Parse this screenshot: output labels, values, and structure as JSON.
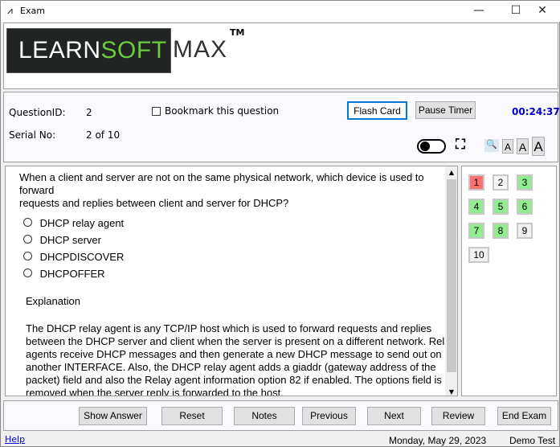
{
  "window": {
    "title": "Exam",
    "minimize": "—",
    "maximize": "☐",
    "close": "✕"
  },
  "logo": {
    "learn": "LEARN",
    "soft": "SOFT",
    "max": "MAX",
    "tm": "TM"
  },
  "info": {
    "question_id_label": "QuestionID:",
    "question_id": "2",
    "serial_label": "Serial No:",
    "serial": "2 of 10",
    "bookmark_label": "Bookmark this question",
    "bookmark_checked": false,
    "flash_card": "Flash Card",
    "pause_timer": "Pause Timer",
    "timer": "00:24:37",
    "font_small": "A",
    "font_medium": "A",
    "font_large": "A"
  },
  "question": {
    "text_line1": "When a client and server are not on the same physical network, which device is used to",
    "text_line2": "forward",
    "text_line3": "requests and replies between client and server for DHCP?",
    "options": [
      "DHCP relay agent",
      "DHCP server",
      "DHCPDISCOVER",
      "DHCPOFFER"
    ],
    "explanation_title": "Explanation",
    "explanation_lines": [
      "The DHCP relay agent is any TCP/IP host which is used to forward requests and replies",
      "between the DHCP server and client when the server is present on a different network. Relay",
      "agents receive DHCP messages and then generate a new DHCP message to send out on",
      "another INTERFACE. Also, the DHCP relay agent adds a giaddr (gateway address of the",
      "packet) field and also the Relay agent information option 82 if enabled. The options field is",
      "removed when the server reply is forwarded to the host."
    ]
  },
  "navigator": [
    {
      "n": "1",
      "status": "incorrect"
    },
    {
      "n": "2",
      "status": "current"
    },
    {
      "n": "3",
      "status": "correct"
    },
    {
      "n": "4",
      "status": "correct"
    },
    {
      "n": "5",
      "status": "correct"
    },
    {
      "n": "6",
      "status": "correct"
    },
    {
      "n": "7",
      "status": "correct"
    },
    {
      "n": "8",
      "status": "correct"
    },
    {
      "n": "9",
      "status": "unanswered"
    },
    {
      "n": "10",
      "status": "unanswered"
    }
  ],
  "colors": {
    "incorrect": "#ff7070",
    "correct": "#90ee90",
    "unanswered": "#f0f0f0",
    "timer": "#0000cc"
  },
  "buttons": {
    "show_answer": "Show Answer",
    "reset": "Reset",
    "notes": "Notes",
    "previous": "Previous",
    "next": "Next",
    "review": "Review",
    "end_exam": "End Exam"
  },
  "status": {
    "help": "Help",
    "date": "Monday, May 29, 2023",
    "mode": "Demo Test"
  }
}
